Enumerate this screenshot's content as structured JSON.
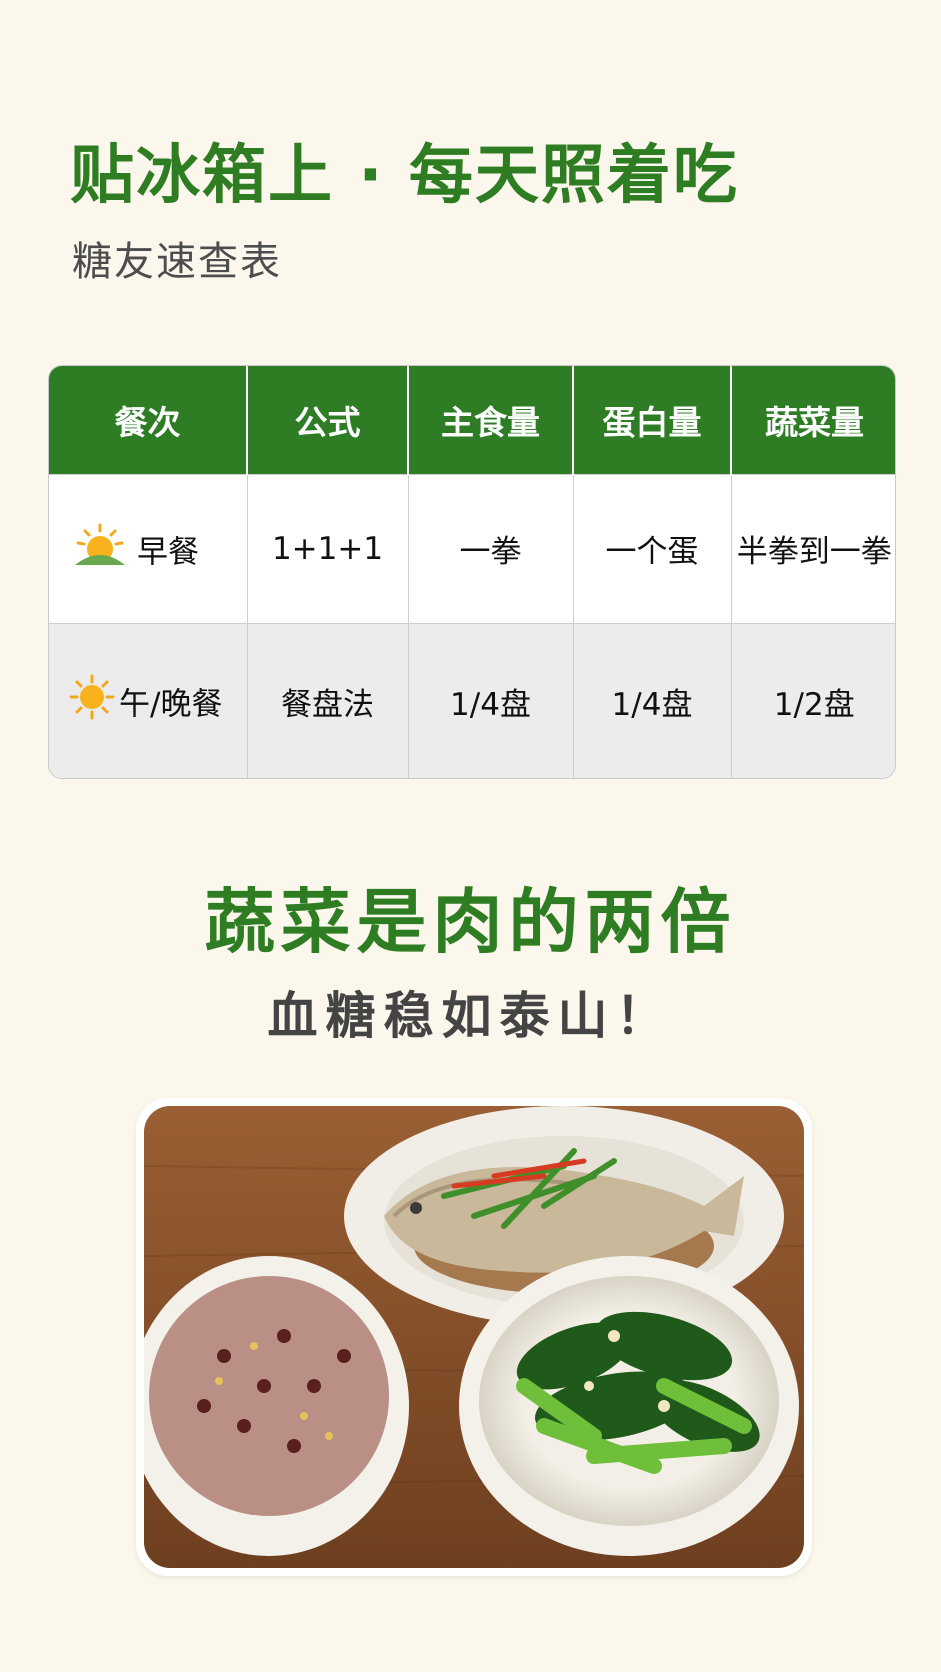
{
  "header": {
    "title": "贴冰箱上 · 每天照着吃",
    "subtitle": "糖友速查表"
  },
  "table": {
    "headers": [
      "餐次",
      "公式",
      "主食量",
      "蛋白量",
      "蔬菜量"
    ],
    "rows": [
      {
        "icon": "sunrise-icon",
        "meal": "早餐",
        "formula": "1+1+1",
        "staple": "一拳",
        "protein": "一个蛋",
        "veg": "半拳到一拳"
      },
      {
        "icon": "sun-icon",
        "meal": "午/晚餐",
        "formula": "餐盘法",
        "staple": "1/4盘",
        "protein": "1/4盘",
        "veg": "1/2盘"
      }
    ]
  },
  "slogan": {
    "main": "蔬菜是肉的两倍",
    "sub": "血糖稳如泰山！"
  },
  "colors": {
    "accent_green": "#2f7d22",
    "background": "#fbf7ec"
  }
}
